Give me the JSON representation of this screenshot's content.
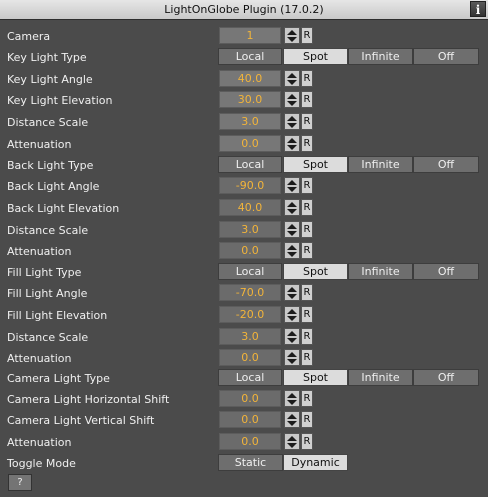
{
  "window": {
    "title": "LightOnGlobe Plugin (17.0.2)",
    "info_label": "i"
  },
  "light_types": [
    "Local",
    "Spot",
    "Infinite",
    "Off"
  ],
  "toggle_modes": [
    "Static",
    "Dynamic"
  ],
  "reset_label": "R",
  "help_label": "?",
  "rows": [
    {
      "kind": "num",
      "label": "Camera",
      "value": "1"
    },
    {
      "kind": "seg",
      "label": "Key Light Type",
      "selected": "Spot"
    },
    {
      "kind": "num",
      "label": "Key Light Angle",
      "value": "40.0"
    },
    {
      "kind": "num",
      "label": "Key Light Elevation",
      "value": "30.0"
    },
    {
      "kind": "num",
      "label": "Distance Scale",
      "value": "3.0"
    },
    {
      "kind": "num",
      "label": "Attenuation",
      "value": "0.0"
    },
    {
      "kind": "seg",
      "label": "Back Light Type",
      "selected": "Spot"
    },
    {
      "kind": "num",
      "label": "Back Light Angle",
      "value": "-90.0",
      "dim": true
    },
    {
      "kind": "num",
      "label": "Back Light Elevation",
      "value": "40.0",
      "dim": true
    },
    {
      "kind": "num",
      "label": "Distance Scale",
      "value": "3.0",
      "dim": true
    },
    {
      "kind": "num",
      "label": "Attenuation",
      "value": "0.0",
      "dim": true
    },
    {
      "kind": "seg",
      "label": "Fill Light Type",
      "selected": "Spot"
    },
    {
      "kind": "num",
      "label": "Fill Light Angle",
      "value": "-70.0",
      "dim": true
    },
    {
      "kind": "num",
      "label": "Fill Light Elevation",
      "value": "-20.0",
      "dim": true
    },
    {
      "kind": "num",
      "label": "Distance Scale",
      "value": "3.0",
      "dim": true
    },
    {
      "kind": "num",
      "label": "Attenuation",
      "value": "0.0",
      "dim": true
    },
    {
      "kind": "seg",
      "label": "Camera Light Type",
      "selected": "Spot"
    },
    {
      "kind": "num",
      "label": "Camera Light Horizontal Shift",
      "value": "0.0",
      "dim": true
    },
    {
      "kind": "num",
      "label": "Camera Light Vertical Shift",
      "value": "0.0",
      "dim": true
    },
    {
      "kind": "num",
      "label": "Attenuation",
      "value": "0.0",
      "dim": true
    },
    {
      "kind": "toggle",
      "label": "Toggle Mode",
      "selected": "Dynamic"
    }
  ]
}
